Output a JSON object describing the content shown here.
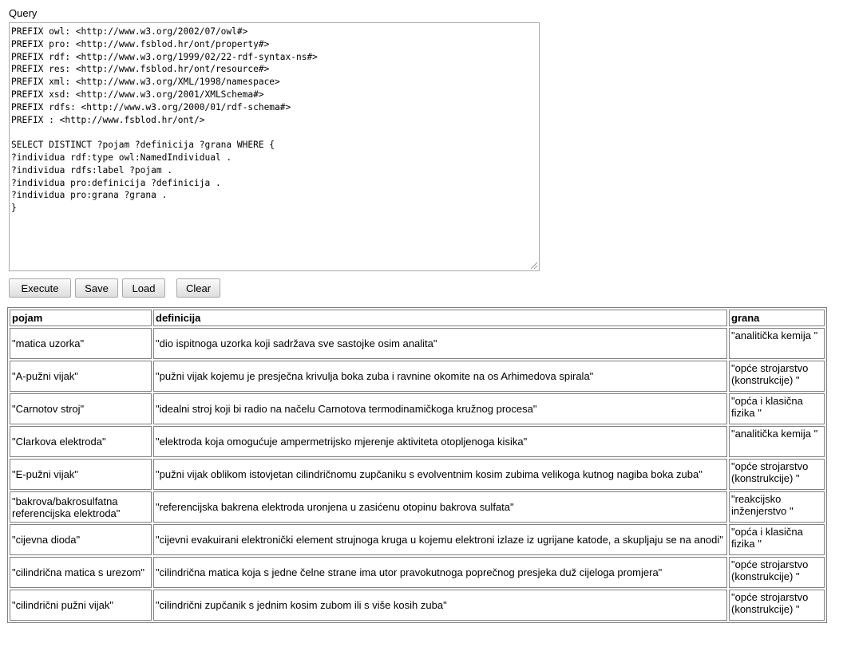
{
  "query_label": "Query",
  "query_text": "PREFIX owl: <http://www.w3.org/2002/07/owl#>\nPREFIX pro: <http://www.fsblod.hr/ont/property#>\nPREFIX rdf: <http://www.w3.org/1999/02/22-rdf-syntax-ns#>\nPREFIX res: <http://www.fsblod.hr/ont/resource#>\nPREFIX xml: <http://www.w3.org/XML/1998/namespace>\nPREFIX xsd: <http://www.w3.org/2001/XMLSchema#>\nPREFIX rdfs: <http://www.w3.org/2000/01/rdf-schema#>\nPREFIX : <http://www.fsblod.hr/ont/>\n\nSELECT DISTINCT ?pojam ?definicija ?grana WHERE {\n?individua rdf:type owl:NamedIndividual .\n?individua rdfs:label ?pojam .\n?individua pro:definicija ?definicija .\n?individua pro:grana ?grana .\n}",
  "buttons": {
    "execute": "Execute",
    "save": "Save",
    "load": "Load",
    "clear": "Clear"
  },
  "table": {
    "headers": [
      "pojam",
      "definicija",
      "grana"
    ],
    "rows": [
      [
        "\"matica uzorka\"",
        "\"dio ispitnoga uzorka koji sadržava sve sastojke osim analita\"",
        "\"analitička kemija \""
      ],
      [
        "\"A-pužni vijak\"",
        "\"pužni vijak kojemu je presječna krivulja boka zuba i ravnine okomite na os Arhimedova spirala\"",
        "\"opće strojarstvo (konstrukcije) \""
      ],
      [
        "\"Carnotov stroj\"",
        "\"idealni stroj koji bi radio na načelu Carnotova termodinamičkoga kružnog procesa\"",
        "\"opća i klasična fizika \""
      ],
      [
        "\"Clarkova elektroda\"",
        "\"elektroda koja omogućuje ampermetrijsko mjerenje aktiviteta otopljenoga kisika\"",
        "\"analitička kemija \""
      ],
      [
        "\"E-pužni vijak\"",
        "\"pužni vijak oblikom istovjetan cilindričnomu zupčaniku s evolventnim kosim zubima velikoga kutnog nagiba boka zuba\"",
        "\"opće strojarstvo (konstrukcije) \""
      ],
      [
        "\"bakrova/bakrosulfatna referencijska elektroda\"",
        "\"referencijska bakrena elektroda uronjena u zasićenu otopinu bakrova sulfata\"",
        "\"reakcijsko inženjerstvo \""
      ],
      [
        "\"cijevna dioda\"",
        "\"cijevni evakuirani elektronički element strujnoga kruga u kojemu elektroni izlaze iz ugrijane katode, a skupljaju se na anodi\"",
        "\"opća i klasična fizika \""
      ],
      [
        "\"cilindrična matica s urezom\"",
        "\"cilindrična matica koja s jedne čelne strane ima utor pravokutnoga poprečnog presjeka duž cijeloga promjera\"",
        "\"opće strojarstvo (konstrukcije) \""
      ],
      [
        "\"cilindrični pužni vijak\"",
        "\"cilindrični zupčanik s jednim kosim zubom ili s više kosih zuba\"",
        "\"opće strojarstvo (konstrukcije) \""
      ]
    ]
  }
}
